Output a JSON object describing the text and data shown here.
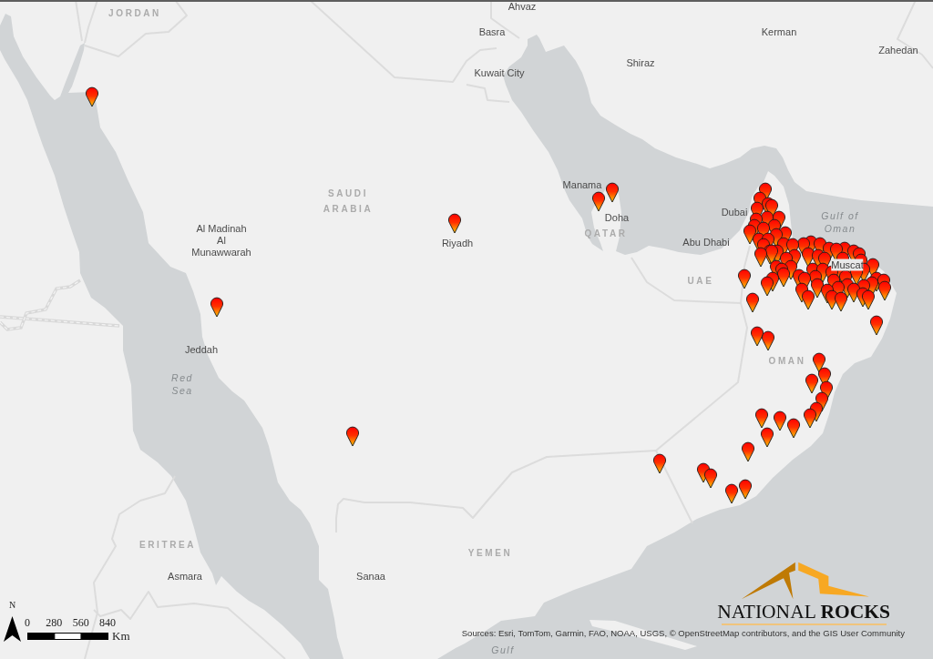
{
  "map": {
    "labels": [
      {
        "text": "Ahvaz",
        "kind": "city"
      },
      {
        "text": "JORDAN",
        "kind": "country"
      },
      {
        "text": "Basra",
        "kind": "city"
      },
      {
        "text": "Kerman",
        "kind": "city"
      },
      {
        "text": "Zahedan",
        "kind": "city"
      },
      {
        "text": "Shiraz",
        "kind": "city"
      },
      {
        "text": "Kuwait City",
        "kind": "city"
      },
      {
        "text": "Manama",
        "kind": "city"
      },
      {
        "text": "SAUDI ARABIA",
        "kind": "country"
      },
      {
        "text": "Dubai",
        "kind": "city"
      },
      {
        "text": "Doha",
        "kind": "city"
      },
      {
        "text": "Gulf of Oman",
        "kind": "sea"
      },
      {
        "text": "Al Madinah Al Munawwarah",
        "kind": "city"
      },
      {
        "text": "Riyadh",
        "kind": "city"
      },
      {
        "text": "QATAR",
        "kind": "country"
      },
      {
        "text": "Abu Dhabi",
        "kind": "city"
      },
      {
        "text": "Muscat",
        "kind": "city"
      },
      {
        "text": "UAE",
        "kind": "country"
      },
      {
        "text": "Jeddah",
        "kind": "city"
      },
      {
        "text": "OMAN",
        "kind": "country"
      },
      {
        "text": "Red Sea",
        "kind": "sea"
      },
      {
        "text": "ERITREA",
        "kind": "country"
      },
      {
        "text": "YEMEN",
        "kind": "country"
      },
      {
        "text": "Asmara",
        "kind": "city"
      },
      {
        "text": "Sanaa",
        "kind": "city"
      },
      {
        "text": "Gulf",
        "kind": "sea"
      }
    ]
  },
  "scale_bar": {
    "north": "N",
    "ticks": [
      "0",
      "280",
      "560",
      "840"
    ],
    "unit": "Km"
  },
  "logo": {
    "wordmark": "NATIONAL **ROCKS**"
  },
  "attribution": "Sources: Esri, TomTom, Garmin, FAO, NOAA, USGS, © OpenStreetMap contributors, and the GIS User Community"
}
